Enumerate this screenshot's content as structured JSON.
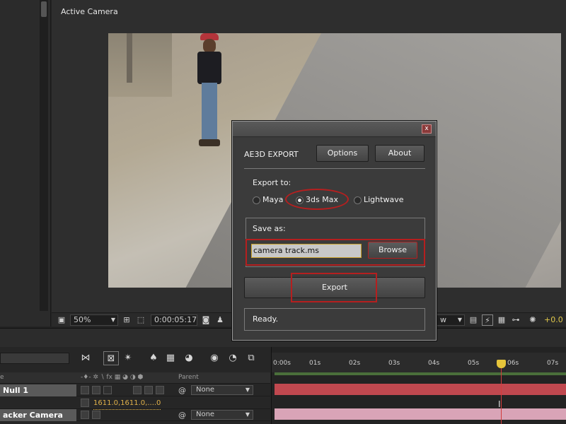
{
  "viewer": {
    "title": "Active Camera",
    "zoom": "50%",
    "timecode": "0:00:05:17",
    "view_fragment": "w",
    "exposure": "+0.0"
  },
  "dialog": {
    "app_title": "AE3D EXPORT",
    "close_glyph": "x",
    "options_label": "Options",
    "about_label": "About",
    "export_to_label": "Export to:",
    "targets": [
      {
        "label": "Maya",
        "selected": false
      },
      {
        "label": "3ds Max",
        "selected": true
      },
      {
        "label": "Lightwave",
        "selected": false
      }
    ],
    "save_as_label": "Save as:",
    "filename": "camera track.ms",
    "browse_label": "Browse",
    "export_label": "Export",
    "status": "Ready."
  },
  "timeline": {
    "header": {
      "left_fragment": "e",
      "parent_label": "Parent"
    },
    "layers": [
      {
        "name": "Null 1",
        "parent": "None"
      },
      {
        "name": "acker Camera",
        "parent": "None"
      }
    ],
    "property_value": "1611.0,1611.0,....0",
    "ruler_ticks": [
      "0:00s",
      "01s",
      "02s",
      "03s",
      "04s",
      "05s",
      "06s",
      "07s"
    ],
    "track_colors": {
      "null": "#c0484f",
      "camera": "#d9a4b7",
      "work_area": "#4a6f3a",
      "playhead": "#d23c3c"
    }
  },
  "icons": [
    "close-icon",
    "snapshot-icon",
    "region-icon",
    "grid-icon",
    "search-icon",
    "solo-icon",
    "motion-blur-icon",
    "graph-editor-icon",
    "parent-link-icon",
    "stopwatch-icon"
  ],
  "colors": {
    "annotation_red": "#b51f1f",
    "accent_yellow": "#e6c53a"
  }
}
